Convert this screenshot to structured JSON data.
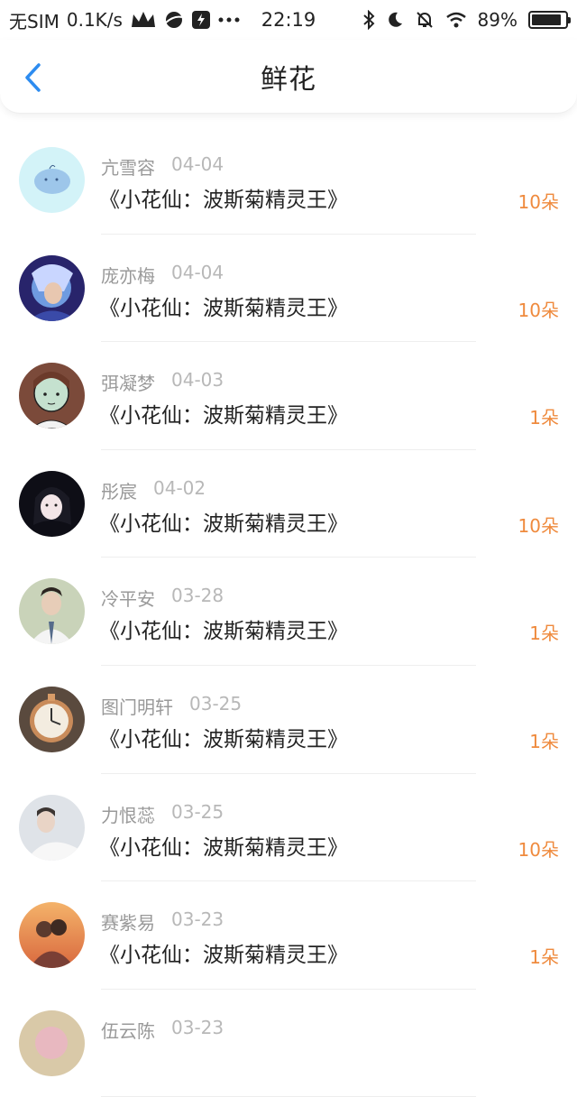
{
  "status_bar": {
    "carrier": "无SIM",
    "speed": "0.1K/s",
    "time": "22:19",
    "battery": "89%",
    "battery_level": 0.89,
    "icons_left": [
      "crown-icon",
      "planet-icon",
      "bolt-app-icon",
      "more-dots-icon"
    ],
    "icons_right": [
      "bluetooth-icon",
      "moon-icon",
      "muted-bell-icon",
      "wifi-icon",
      "battery-icon"
    ]
  },
  "navbar": {
    "title": "鲜花",
    "back_icon": "chevron-left-icon",
    "accent": "#2d8cf0"
  },
  "colors": {
    "quantity": "#ef8a3d",
    "name": "#999999",
    "date": "#b8b8b8"
  },
  "records": [
    {
      "name": "亢雪容",
      "date": "04-04",
      "book": "《小花仙：波斯菊精灵王》",
      "qty": "10朵",
      "avatar": "avatar-light-blue"
    },
    {
      "name": "庞亦梅",
      "date": "04-04",
      "book": "《小花仙：波斯菊精灵王》",
      "qty": "10朵",
      "avatar": "avatar-game-hero"
    },
    {
      "name": "弭凝梦",
      "date": "04-03",
      "book": "《小花仙：波斯菊精灵王》",
      "qty": "1朵",
      "avatar": "avatar-cartoon-girl"
    },
    {
      "name": "彤宸",
      "date": "04-02",
      "book": "《小花仙：波斯菊精灵王》",
      "qty": "10朵",
      "avatar": "avatar-dark-girl"
    },
    {
      "name": "冷平安",
      "date": "03-28",
      "book": "《小花仙：波斯菊精灵王》",
      "qty": "1朵",
      "avatar": "avatar-suit-man"
    },
    {
      "name": "图门明轩",
      "date": "03-25",
      "book": "《小花仙：波斯菊精灵王》",
      "qty": "1朵",
      "avatar": "avatar-watch"
    },
    {
      "name": "力恨蕊",
      "date": "03-25",
      "book": "《小花仙：波斯菊精灵王》",
      "qty": "10朵",
      "avatar": "avatar-white-shirt"
    },
    {
      "name": "赛紫易",
      "date": "03-23",
      "book": "《小花仙：波斯菊精灵王》",
      "qty": "1朵",
      "avatar": "avatar-sunset-couple"
    },
    {
      "name": "伍云陈",
      "date": "03-23",
      "book": "",
      "qty": "",
      "avatar": "avatar-partial"
    }
  ]
}
